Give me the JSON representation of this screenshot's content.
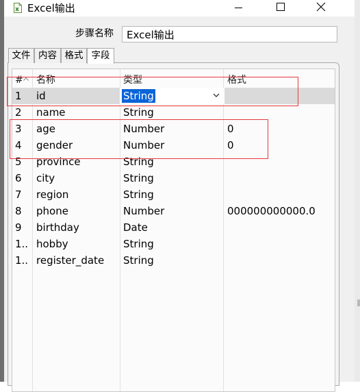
{
  "window": {
    "title": "Excel输出",
    "controls": [
      "minimize",
      "maximize",
      "close"
    ]
  },
  "form": {
    "step_name_label": "步骤名称",
    "step_name_value": "Excel输出"
  },
  "tabs": [
    {
      "label": "文件",
      "active": false
    },
    {
      "label": "内容",
      "active": false
    },
    {
      "label": "格式",
      "active": false
    },
    {
      "label": "字段",
      "active": true
    }
  ],
  "table": {
    "headers": {
      "num": "#",
      "name": "名称",
      "type": "类型",
      "format": "格式"
    },
    "rows": [
      {
        "num": "1",
        "name": "id",
        "type": "String",
        "format": ""
      },
      {
        "num": "2",
        "name": "name",
        "type": "String",
        "format": ""
      },
      {
        "num": "3",
        "name": "age",
        "type": "Number",
        "format": "0"
      },
      {
        "num": "4",
        "name": "gender",
        "type": "Number",
        "format": "0"
      },
      {
        "num": "5",
        "name": "province",
        "type": "String",
        "format": ""
      },
      {
        "num": "6",
        "name": "city",
        "type": "String",
        "format": ""
      },
      {
        "num": "7",
        "name": "region",
        "type": "String",
        "format": ""
      },
      {
        "num": "8",
        "name": "phone",
        "type": "Number",
        "format": "000000000000.0"
      },
      {
        "num": "9",
        "name": "birthday",
        "type": "Date",
        "format": ""
      },
      {
        "num": "1..",
        "name": "hobby",
        "type": "String",
        "format": ""
      },
      {
        "num": "1..",
        "name": "register_date",
        "type": "String",
        "format": ""
      }
    ],
    "selected_row": 1,
    "editing_type_value": "String"
  },
  "annotations": {
    "color": "#e8393d"
  }
}
